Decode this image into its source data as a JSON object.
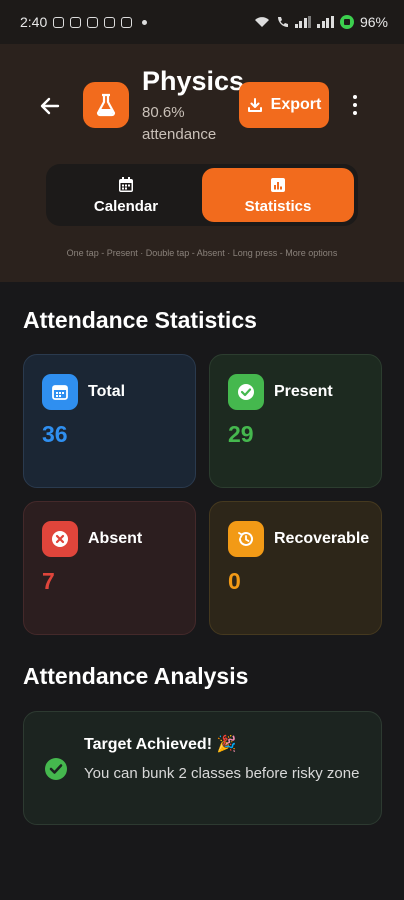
{
  "status_bar": {
    "time": "2:40",
    "battery": "96%"
  },
  "header": {
    "subject_name": "Physics",
    "attendance_text": "80.6% attendance",
    "export_label": "Export",
    "toggle": {
      "calendar_label": "Calendar",
      "statistics_label": "Statistics",
      "selected": "Statistics"
    },
    "hint": "One tap - Present · Double tap - Absent · Long press - More options"
  },
  "statistics": {
    "title": "Attendance Statistics",
    "cards": [
      {
        "label": "Total",
        "value": "36",
        "icon": "calendar-icon",
        "color": "#2f8ff0"
      },
      {
        "label": "Present",
        "value": "29",
        "icon": "check-circle-icon",
        "color": "#45b84e"
      },
      {
        "label": "Absent",
        "value": "7",
        "icon": "x-circle-icon",
        "color": "#e0453b"
      },
      {
        "label": "Recoverable",
        "value": "0",
        "icon": "history-icon",
        "color": "#f29a16"
      }
    ]
  },
  "analysis": {
    "title": "Attendance Analysis",
    "card_title": "Target Achieved! 🎉",
    "card_body": "You can bunk 2 classes before risky zone",
    "icon": "check-circle-icon"
  },
  "colors": {
    "accent": "#f26b1d",
    "background": "#18181a",
    "header_bg": "#2b221d"
  }
}
